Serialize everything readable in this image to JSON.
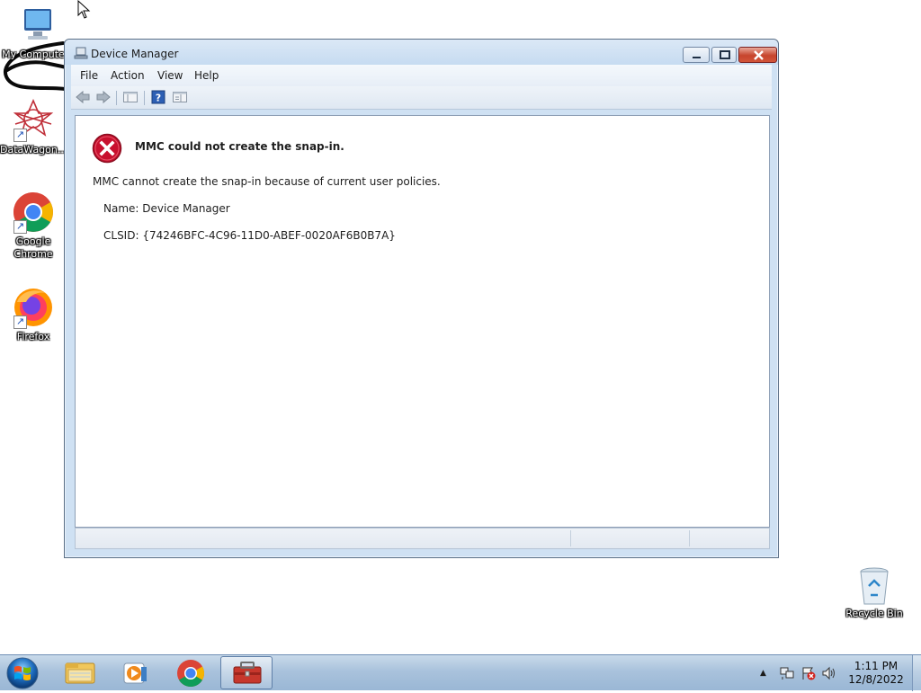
{
  "desktop": {
    "icons": [
      {
        "label": "My Compute",
        "icon": "computer-icon"
      },
      {
        "label": "DataWagon...",
        "icon": "datawagon-icon"
      },
      {
        "label": "Google Chrome",
        "icon": "chrome-icon"
      },
      {
        "label": "Firefox",
        "icon": "firefox-icon"
      },
      {
        "label": "Recycle Bin",
        "icon": "recycle-bin-icon"
      }
    ]
  },
  "window": {
    "title": "Device Manager",
    "menu": [
      "File",
      "Action",
      "View",
      "Help"
    ],
    "toolbar": [
      "back-icon",
      "forward-icon",
      "show-hide-console-tree-icon",
      "help-icon",
      "properties-icon"
    ],
    "error": {
      "title": "MMC could not create the snap-in.",
      "message": "MMC cannot create the snap-in because of current user policies.",
      "name_line": "Name: Device Manager",
      "clsid_line": "CLSID: {74246BFC-4C96-11D0-ABEF-0020AF6B0B7A}"
    }
  },
  "taskbar": {
    "apps": [
      "windows-explorer-icon",
      "media-player-icon",
      "chrome-icon",
      "device-manager-toolbox-icon"
    ],
    "tray": [
      "network-icon",
      "action-center-icon",
      "volume-icon"
    ],
    "time": "1:11 PM",
    "date": "12/8/2022"
  },
  "colors": {
    "taskbar": "#a9c2dc",
    "window_frame": "#cfe1f3",
    "close_button": "#c7442d",
    "error_icon": "#c8102e"
  }
}
